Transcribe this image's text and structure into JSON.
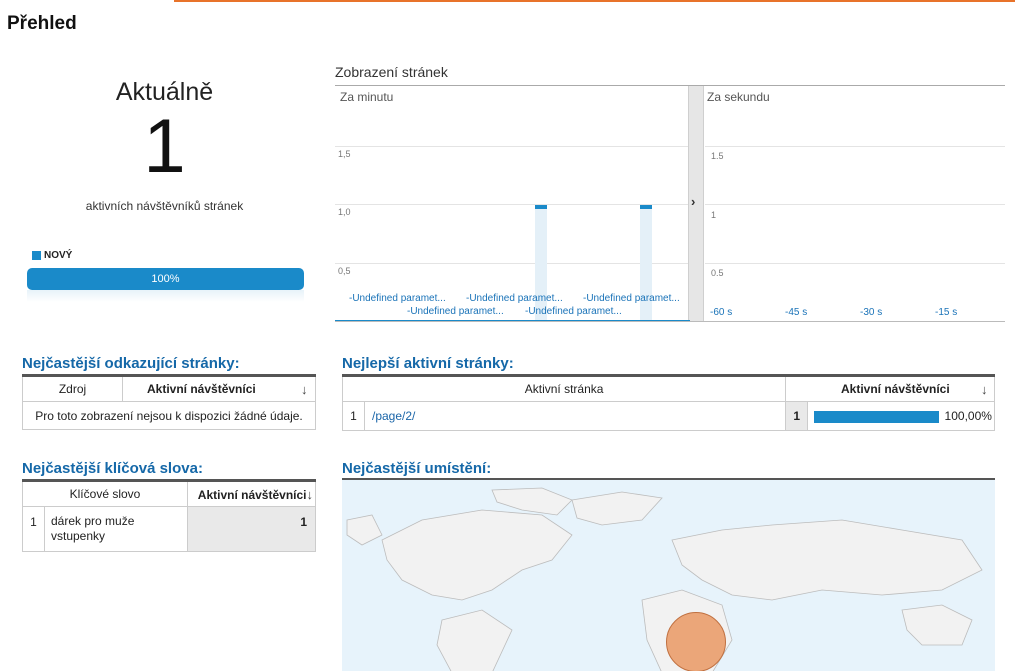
{
  "page": {
    "title": "Přehled"
  },
  "realtime": {
    "heading": "Aktuálně",
    "count": "1",
    "caption": "aktivních návštěvníků stránek",
    "legend_label": "NOVÝ",
    "bar_label": "100%",
    "bar_percent": 100,
    "accent": "#1a8ac9"
  },
  "pageviews_chart": {
    "title": "Zobrazení stránek",
    "minute_label": "Za minutu",
    "second_label": "Za sekundu",
    "chart_data": {
      "type": "bar",
      "minute_yticks": [
        "1,5",
        "1,0",
        "0,5"
      ],
      "second_yticks": [
        "1.5",
        "1",
        "0.5"
      ],
      "minute_xticks": [
        "-Undefined paramet...",
        "-Undefined paramet...",
        "-Undefined paramet...",
        "-Undefined paramet...",
        "-Undefined paramet..."
      ],
      "second_xticks": [
        "-60 s",
        "-45 s",
        "-30 s",
        "-15 s"
      ],
      "bars": [
        {
          "x_index": 2,
          "value": 1
        },
        {
          "x_index": 4,
          "value": 1
        }
      ],
      "ylim": [
        0,
        1.5
      ]
    }
  },
  "referrals": {
    "title": "Nejčastější odkazující stránky:",
    "col_source": "Zdroj",
    "col_visitors": "Aktivní návštěvníci",
    "empty": "Pro toto zobrazení nejsou k dispozici žádné údaje."
  },
  "top_pages": {
    "title": "Nejlepší aktivní stránky:",
    "col_page": "Aktivní stránka",
    "col_visitors": "Aktivní návštěvníci",
    "rows": [
      {
        "rank": "1",
        "page": "/page/2/",
        "visitors": "1",
        "percent": "100,00%"
      }
    ]
  },
  "keywords": {
    "title": "Nejčastější klíčová slova:",
    "col_keyword": "Klíčové slovo",
    "col_visitors": "Aktivní návštěvníci",
    "rows": [
      {
        "rank": "1",
        "keyword": "dárek pro muže vstupenky",
        "visitors": "1"
      }
    ]
  },
  "locations": {
    "title": "Nejčastější umístění:"
  },
  "icons": {
    "sort": "arrow-down-icon",
    "expand": "chevron-right-icon"
  }
}
